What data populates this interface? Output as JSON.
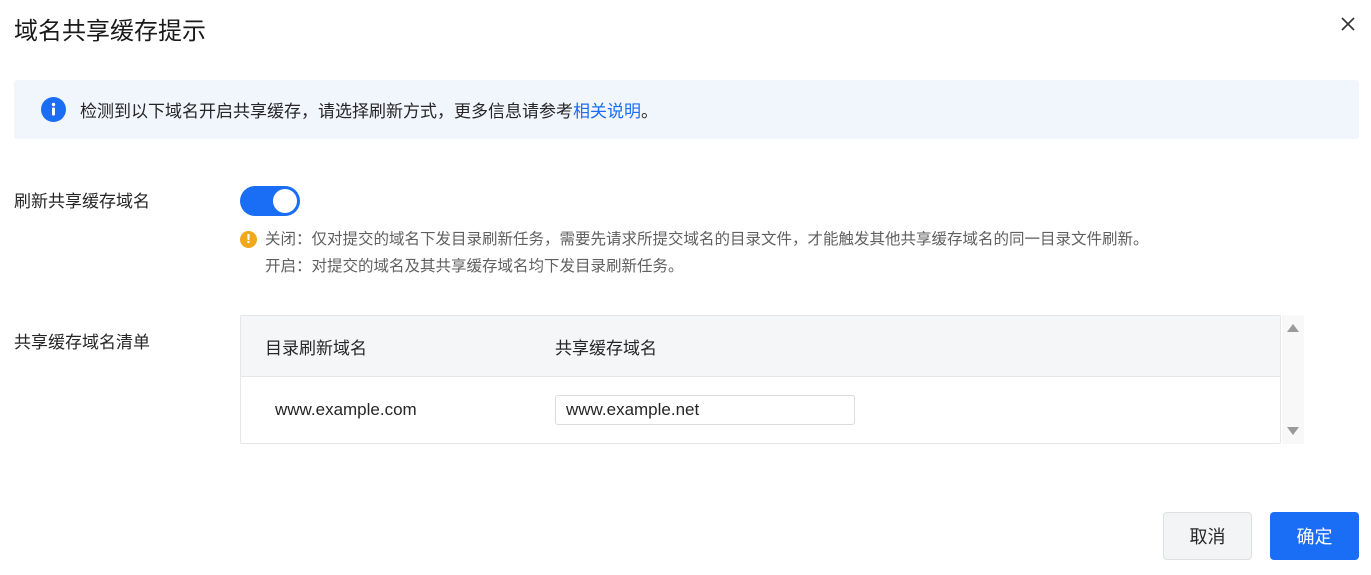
{
  "dialog": {
    "title": "域名共享缓存提示"
  },
  "alert": {
    "text": "检测到以下域名开启共享缓存，请选择刷新方式，更多信息请参考",
    "link": "相关说明",
    "suffix": "。"
  },
  "refresh_shared": {
    "label": "刷新共享缓存域名",
    "enabled": true,
    "hint_off": "关闭：仅对提交的域名下发目录刷新任务，需要先请求所提交域名的目录文件，才能触发其他共享缓存域名的同一目录文件刷新。",
    "hint_on": "开启：对提交的域名及其共享缓存域名均下发目录刷新任务。"
  },
  "shared_list": {
    "label": "共享缓存域名清单",
    "columns": [
      "目录刷新域名",
      "共享缓存域名"
    ],
    "rows": [
      {
        "refresh_domain": "www.example.com",
        "shared_domain": "www.example.net"
      }
    ]
  },
  "footer": {
    "cancel": "取消",
    "ok": "确定"
  },
  "colors": {
    "primary": "#1a6df5",
    "warning": "#f0a91d",
    "alert_bg": "#f1f5fc"
  }
}
